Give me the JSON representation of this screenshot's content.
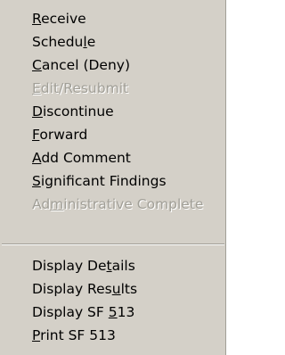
{
  "menu": {
    "groups": [
      {
        "items": [
          {
            "pre": "",
            "key": "R",
            "post": "eceive",
            "disabled": false,
            "name": "menu-item-receive"
          },
          {
            "pre": "Schedu",
            "key": "l",
            "post": "e",
            "disabled": false,
            "name": "menu-item-schedule"
          },
          {
            "pre": "",
            "key": "C",
            "post": "ancel (Deny)",
            "disabled": false,
            "name": "menu-item-cancel-deny"
          },
          {
            "pre": "",
            "key": "E",
            "post": "dit/Resubmit",
            "disabled": true,
            "name": "menu-item-edit-resubmit"
          },
          {
            "pre": "",
            "key": "D",
            "post": "iscontinue",
            "disabled": false,
            "name": "menu-item-discontinue"
          },
          {
            "pre": "",
            "key": "F",
            "post": "orward",
            "disabled": false,
            "name": "menu-item-forward"
          },
          {
            "pre": "",
            "key": "A",
            "post": "dd Comment",
            "disabled": false,
            "name": "menu-item-add-comment"
          },
          {
            "pre": "",
            "key": "S",
            "post": "ignificant Findings",
            "disabled": false,
            "name": "menu-item-significant-findings"
          },
          {
            "pre": "Ad",
            "key": "m",
            "post": "inistrative Complete",
            "disabled": true,
            "name": "menu-item-administrative-complete"
          }
        ]
      },
      {
        "items": [
          {
            "pre": "Display De",
            "key": "t",
            "post": "ails",
            "disabled": false,
            "name": "menu-item-display-details"
          },
          {
            "pre": "Display Res",
            "key": "u",
            "post": "lts",
            "disabled": false,
            "name": "menu-item-display-results"
          },
          {
            "pre": "Display SF ",
            "key": "5",
            "post": "13",
            "disabled": false,
            "name": "menu-item-display-sf-513"
          },
          {
            "pre": "",
            "key": "P",
            "post": "rint SF 513",
            "disabled": false,
            "name": "menu-item-print-sf-513"
          }
        ]
      }
    ]
  }
}
